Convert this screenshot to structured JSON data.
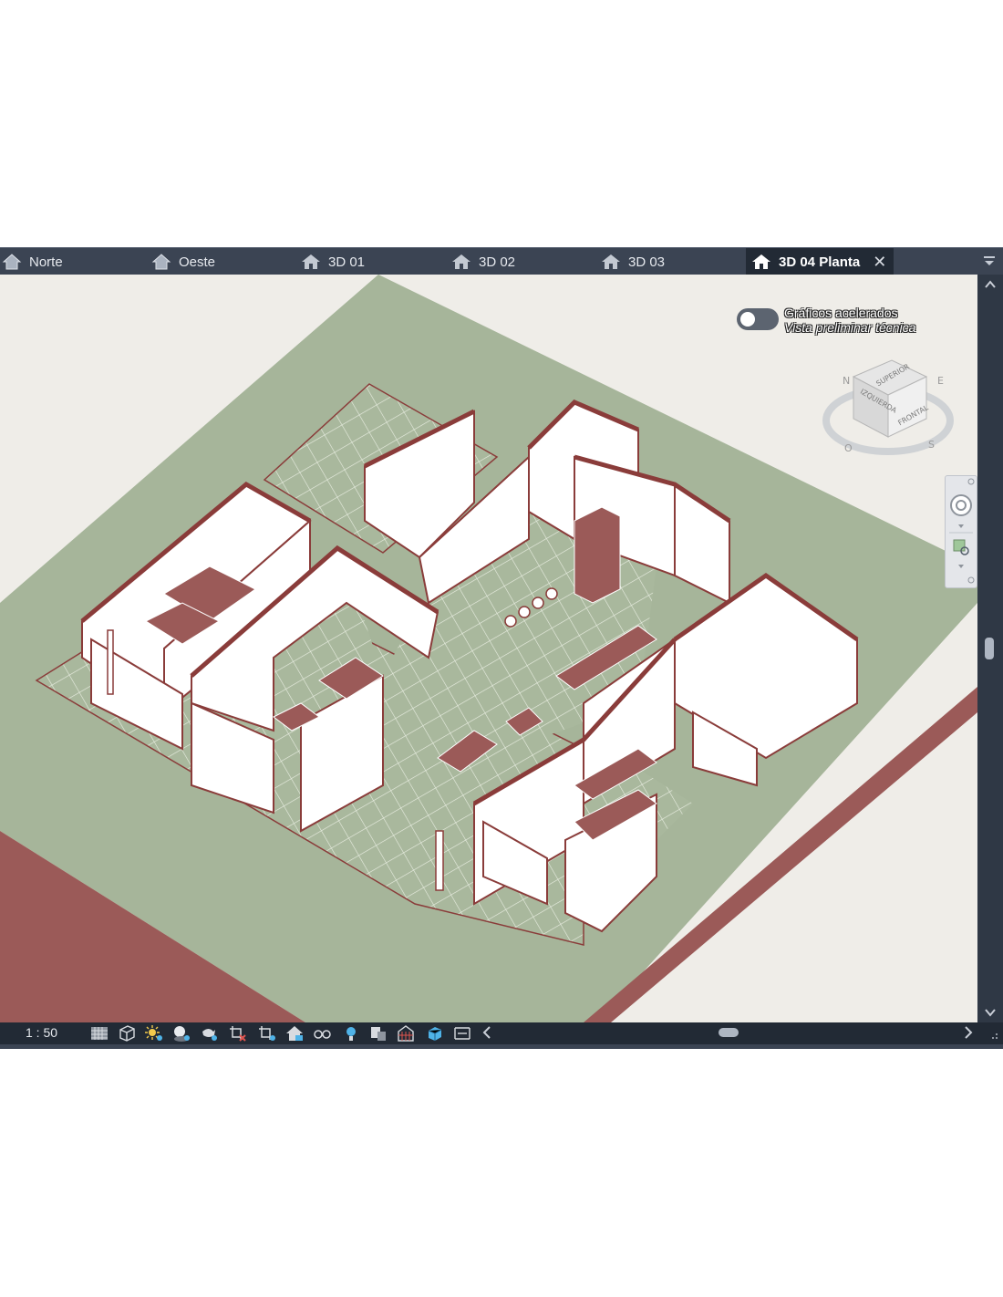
{
  "tabs": [
    {
      "label": "Norte",
      "icon": "elevation-view-icon"
    },
    {
      "label": "Oeste",
      "icon": "elevation-view-icon"
    },
    {
      "label": "3D 01",
      "icon": "3d-house-view-icon"
    },
    {
      "label": "3D 02",
      "icon": "3d-house-view-icon"
    },
    {
      "label": "3D 03",
      "icon": "3d-house-view-icon"
    },
    {
      "label": "3D 04 Planta",
      "icon": "3d-house-view-icon",
      "active": true,
      "close": "✕"
    }
  ],
  "overlay": {
    "accelerated_graphics": "Gráficos acelerados",
    "preview_mode": "Vista preliminar técnica"
  },
  "viewcube": {
    "faces": {
      "top": "SUPERIOR",
      "left": "IZQUIERDA",
      "front": "FRONTAL"
    },
    "compass": [
      "N",
      "E",
      "S",
      "O"
    ]
  },
  "statusbar": {
    "scale": "1 : 50",
    "tools": [
      "detail-level-icon",
      "visual-style-cube-icon",
      "sun-path-icon",
      "shadows-icon",
      "render-teapot-icon",
      "crop-view-icon",
      "show-crop-region-icon",
      "lock-3d-view-icon",
      "temporary-hide-icon",
      "reveal-hidden-icon",
      "worksharing-display-icon",
      "analytical-model-icon",
      "highlight-displacement-icon",
      "reveal-constraints-icon"
    ]
  },
  "colors": {
    "wall_fill": "#ffffff",
    "wall_outline": "#8a3c3a",
    "furniture": "#9b5a58",
    "floor_tile": "#a9b89d",
    "canvas_bg": "#efede8",
    "tab_bg": "#3b4453",
    "active_tab_bg": "#222a35"
  }
}
